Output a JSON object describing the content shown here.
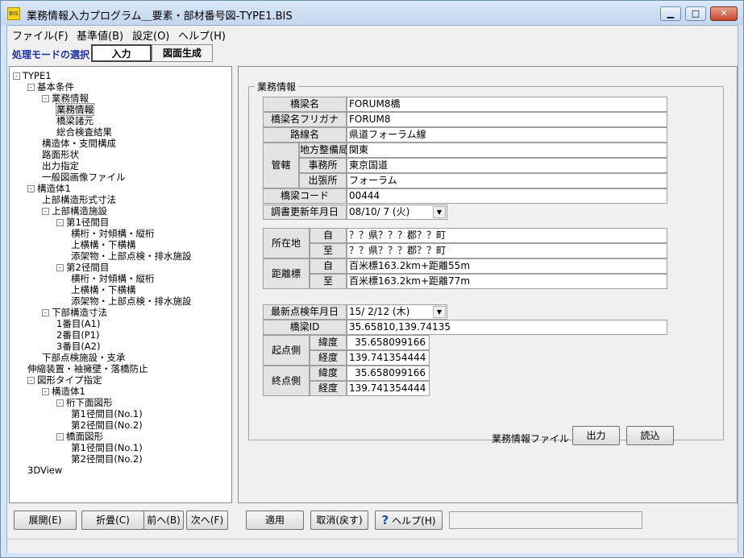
{
  "window": {
    "title": "業務情報入力プログラム＿要素・部材番号図-TYPE1.BIS",
    "icon_text": "BIS",
    "minimize": "▁",
    "maximize": "□",
    "close": "✕"
  },
  "menu": [
    "ファイル(F)",
    "基準値(B)",
    "設定(O)",
    "ヘルプ(H)"
  ],
  "mode": {
    "label": "処理モードの選択",
    "buttons": [
      "入力",
      "図面生成"
    ],
    "active": "入力"
  },
  "tree": [
    {
      "label": "TYPE1",
      "toggle": "-",
      "depth": 0
    },
    {
      "label": "基本条件",
      "toggle": "-",
      "depth": 1
    },
    {
      "label": "業務情報",
      "toggle": "-",
      "depth": 2
    },
    {
      "label": "業務情報",
      "toggle": "",
      "depth": 3,
      "selected": true
    },
    {
      "label": "橋梁諸元",
      "toggle": "",
      "depth": 3
    },
    {
      "label": "総合検査結果",
      "toggle": "",
      "depth": 3
    },
    {
      "label": "構造体・支間構成",
      "toggle": "",
      "depth": 2
    },
    {
      "label": "路面形状",
      "toggle": "",
      "depth": 2
    },
    {
      "label": "出力指定",
      "toggle": "",
      "depth": 2
    },
    {
      "label": "一般図画像ファイル",
      "toggle": "",
      "depth": 2
    },
    {
      "label": "構造体1",
      "toggle": "-",
      "depth": 1
    },
    {
      "label": "上部構造形式寸法",
      "toggle": "",
      "depth": 2
    },
    {
      "label": "上部構造施設",
      "toggle": "-",
      "depth": 2
    },
    {
      "label": "第1径間目",
      "toggle": "-",
      "depth": 3
    },
    {
      "label": "横桁・対傾構・縦桁",
      "toggle": "",
      "depth": 4
    },
    {
      "label": "上横構・下横構",
      "toggle": "",
      "depth": 4
    },
    {
      "label": "添架物・上部点検・排水施設",
      "toggle": "",
      "depth": 4
    },
    {
      "label": "第2径間目",
      "toggle": "-",
      "depth": 3
    },
    {
      "label": "横桁・対傾構・縦桁",
      "toggle": "",
      "depth": 4
    },
    {
      "label": "上横構・下横構",
      "toggle": "",
      "depth": 4
    },
    {
      "label": "添架物・上部点検・排水施設",
      "toggle": "",
      "depth": 4
    },
    {
      "label": "下部構造寸法",
      "toggle": "-",
      "depth": 2
    },
    {
      "label": "1番目(A1)",
      "toggle": "",
      "depth": 3
    },
    {
      "label": "2番目(P1)",
      "toggle": "",
      "depth": 3
    },
    {
      "label": "3番目(A2)",
      "toggle": "",
      "depth": 3
    },
    {
      "label": "下部点検施設・支承",
      "toggle": "",
      "depth": 2
    },
    {
      "label": "伸縮装置・袖擁壁・落橋防止",
      "toggle": "",
      "depth": 1
    },
    {
      "label": "図形タイプ指定",
      "toggle": "-",
      "depth": 1
    },
    {
      "label": "構造体1",
      "toggle": "-",
      "depth": 2
    },
    {
      "label": "桁下面図形",
      "toggle": "-",
      "depth": 3
    },
    {
      "label": "第1径間目(No.1)",
      "toggle": "",
      "depth": 4
    },
    {
      "label": "第2径間目(No.2)",
      "toggle": "",
      "depth": 4
    },
    {
      "label": "橋面図形",
      "toggle": "-",
      "depth": 3
    },
    {
      "label": "第1径間目(No.1)",
      "toggle": "",
      "depth": 4
    },
    {
      "label": "第2径間目(No.2)",
      "toggle": "",
      "depth": 4
    },
    {
      "label": "3DView",
      "toggle": "",
      "depth": 1
    }
  ],
  "tree_buttons": [
    "展開(E)",
    "折畳(C)",
    "前へ(B)",
    "次へ(F)"
  ],
  "form": {
    "group_title": "業務情報",
    "bridge_name_label": "橋梁名",
    "bridge_name": "FORUM8橋",
    "furigana_label": "橋梁名フリガナ",
    "furigana": "FORUM8",
    "route_label": "路線名",
    "route": "県道フォーラム線",
    "jurisdiction_label": "管轄",
    "bureau_label": "地方整備局",
    "bureau": "関東",
    "office_label": "事務所",
    "office": "東京国道",
    "branch_label": "出張所",
    "branch": "フォーラム",
    "code_label": "橋梁コード",
    "code": "00444",
    "updated_label": "調書更新年月日",
    "updated": "08/10/ 7 (火)",
    "location_label": "所在地",
    "from_label": "自",
    "location_from": "？？県？？？郡？？町",
    "to_label": "至",
    "location_to": "？？県？？？郡？？町",
    "distance_label": "距離標",
    "distance_from": "百米標163.2km+距離55m",
    "distance_to": "百米標163.2km+距離77m",
    "inspection_label": "最新点検年月日",
    "inspection": "15/ 2/12 (木)",
    "id_label": "橋梁ID",
    "bridge_id": "35.65810,139.74135",
    "start_label": "起点側",
    "lat_label": "緯度",
    "lon_label": "経度",
    "start_lat": "35.658099166",
    "start_lon": "139.741354444",
    "end_label": "終点側",
    "end_lat": "35.658099166",
    "end_lon": "139.741354444",
    "file_label": "業務情報ファイル",
    "output_button": "出力",
    "read_button": "読込"
  },
  "bottom_buttons": {
    "apply": "適用",
    "cancel": "取消(戻す)",
    "help": "ヘルプ(H)",
    "help_icon": "?"
  }
}
